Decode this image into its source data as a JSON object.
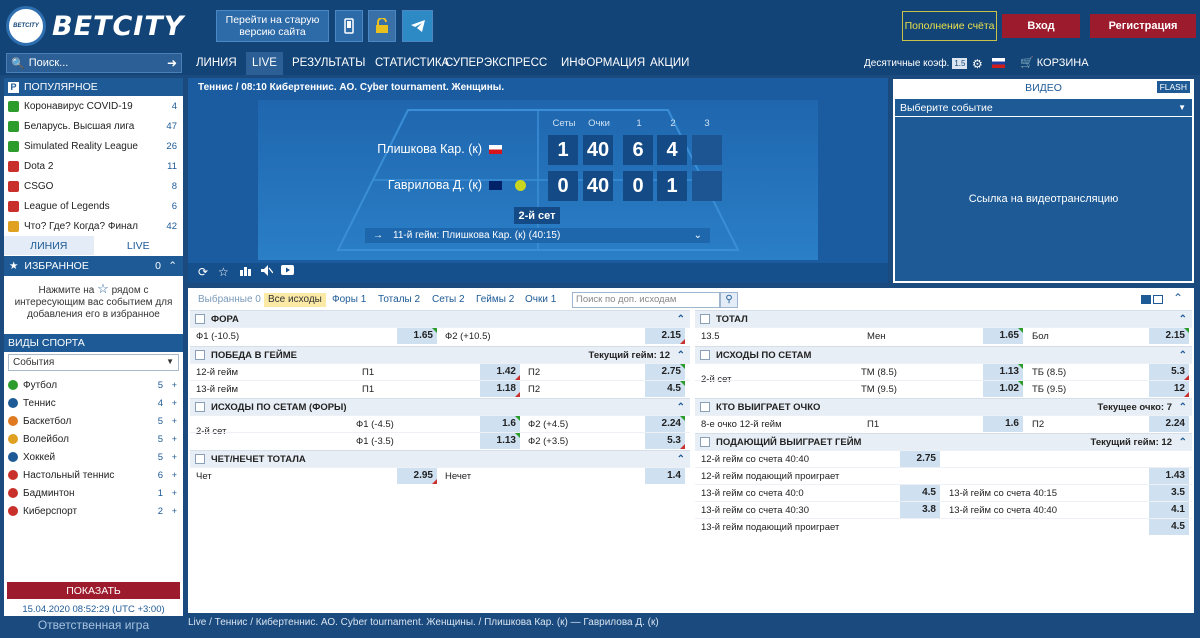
{
  "header": {
    "logo_badge": "BETCITY",
    "logo_text": "BETCITY",
    "old_version": "Перейти на старую версию сайта",
    "topup": "Пополнение счёта",
    "login": "Вход",
    "register": "Регистрация"
  },
  "nav": {
    "search_placeholder": "Поиск...",
    "items": [
      "ЛИНИЯ",
      "LIVE",
      "РЕЗУЛЬТАТЫ",
      "СТАТИСТИКА",
      "СУПЕРЭКСПРЕСС",
      "ИНФОРМАЦИЯ",
      "АКЦИИ"
    ],
    "decimal": "Десятичные коэф.",
    "decimal_badge": "1.5",
    "cart": "КОРЗИНА"
  },
  "sidebar": {
    "popular_title": "ПОПУЛЯРНОЕ",
    "popular": [
      {
        "label": "Коронавирус COVID-19",
        "count": "4",
        "color": "#2c9c2c"
      },
      {
        "label": "Беларусь. Высшая лига",
        "count": "47",
        "color": "#2c9c2c"
      },
      {
        "label": "Simulated Reality League",
        "count": "26",
        "color": "#2c9c2c"
      },
      {
        "label": "Dota 2",
        "count": "11",
        "color": "#c9302c"
      },
      {
        "label": "CSGO",
        "count": "8",
        "color": "#c9302c"
      },
      {
        "label": "League of Legends",
        "count": "6",
        "color": "#c9302c"
      },
      {
        "label": "Что? Где? Когда? Финал",
        "count": "42",
        "color": "#e0a020"
      }
    ],
    "tab_line": "ЛИНИЯ",
    "tab_live": "LIVE",
    "fav_title": "ИЗБРАННОЕ",
    "fav_count": "0",
    "fav_text_1": "Нажмите на",
    "fav_text_2": "рядом с интересующим вас событием для добавления его в избранное",
    "sports_title": "ВИДЫ СПОРТА",
    "sports_select": "События",
    "sports": [
      {
        "label": "Футбол",
        "count": "5",
        "color": "#2c9c2c"
      },
      {
        "label": "Теннис",
        "count": "4",
        "color": "#1d5a96"
      },
      {
        "label": "Баскетбол",
        "count": "5",
        "color": "#e07a20"
      },
      {
        "label": "Волейбол",
        "count": "5",
        "color": "#e0a020"
      },
      {
        "label": "Хоккей",
        "count": "5",
        "color": "#1d5a96"
      },
      {
        "label": "Настольный теннис",
        "count": "6",
        "color": "#c9302c"
      },
      {
        "label": "Бадминтон",
        "count": "1",
        "color": "#c9302c"
      },
      {
        "label": "Киберспорт",
        "count": "2",
        "color": "#c9302c"
      }
    ],
    "show": "ПОКАЗАТЬ",
    "datetime": "15.04.2020 08:52:29 (UTC +3:00)",
    "responsible": "Ответственная игра"
  },
  "match": {
    "title": "Теннис  /  08:10 Кибертеннис. АО. Cyber tournament. Женщины.",
    "headers": [
      "Сеты",
      "Очки",
      "1",
      "2",
      "3"
    ],
    "player1": {
      "name": "Плишкова Кар. (к)",
      "scores": [
        "1",
        "40",
        "6",
        "4",
        ""
      ]
    },
    "player2": {
      "name": "Гаврилова Д. (к)",
      "scores": [
        "0",
        "40",
        "0",
        "1",
        ""
      ]
    },
    "set": "2-й сет",
    "game": "11-й гейм: Плишкова Кар. (к) (40:15)"
  },
  "video": {
    "tab": "ВИДЕО",
    "flash": "FLASH",
    "select": "Выберите событие",
    "link": "Ссылка на видеотрансляцию"
  },
  "markets": {
    "tabs": [
      "Выбранные 0",
      "Все исходы",
      "Форы 1",
      "Тоталы 2",
      "Сеты 2",
      "Геймы 2",
      "Очки 1"
    ],
    "search_placeholder": "Поиск по доп. исходам",
    "fora": {
      "title": "ФОРА",
      "r1": [
        "Ф1 (-10.5)",
        "1.65",
        "Ф2 (+10.5)",
        "2.15"
      ]
    },
    "pobeda": {
      "title": "ПОБЕДА В ГЕЙМЕ",
      "right": "Текущий гейм: 12",
      "rows": [
        [
          "12-й гейм",
          "П1",
          "1.42",
          "П2",
          "2.75"
        ],
        [
          "13-й гейм",
          "П1",
          "1.18",
          "П2",
          "4.5"
        ]
      ]
    },
    "sety_fora": {
      "title": "ИСХОДЫ ПО СЕТАМ (ФОРЫ)",
      "label": "2-й сет",
      "rows": [
        [
          "Ф1 (-4.5)",
          "1.6",
          "Ф2 (+4.5)",
          "2.24"
        ],
        [
          "Ф1 (-3.5)",
          "1.13",
          "Ф2 (+3.5)",
          "5.3"
        ]
      ]
    },
    "chet": {
      "title": "ЧЕТ/НЕЧЕТ ТОТАЛА",
      "r1": [
        "Чет",
        "2.95",
        "Нечет",
        "1.4"
      ]
    },
    "total": {
      "title": "ТОТАЛ",
      "r1": [
        "13.5",
        "Мен",
        "1.65",
        "Бол",
        "2.15"
      ]
    },
    "sety": {
      "title": "ИСХОДЫ ПО СЕТАМ",
      "label": "2-й сет",
      "rows": [
        [
          "ТМ (8.5)",
          "1.13",
          "ТБ (8.5)",
          "5.3"
        ],
        [
          "ТМ (9.5)",
          "1.02",
          "ТБ (9.5)",
          "12"
        ]
      ]
    },
    "ochko": {
      "title": "КТО ВЫИГРАЕТ ОЧКО",
      "right": "Текущее очко: 7",
      "r1": [
        "8-е очко 12-й гейм",
        "П1",
        "1.6",
        "П2",
        "2.24"
      ]
    },
    "podayushchiy": {
      "title": "ПОДАЮЩИЙ ВЫИГРАЕТ ГЕЙМ",
      "right": "Текущий гейм: 12",
      "r1": [
        "12-й гейм со счета 40:40",
        "2.75"
      ],
      "r2": [
        "12-й гейм подающий проиграет",
        "1.43"
      ],
      "r3": [
        "13-й гейм со счета 40:0",
        "4.5",
        "13-й гейм со счета 40:15",
        "3.5"
      ],
      "r4": [
        "13-й гейм со счета 40:30",
        "3.8",
        "13-й гейм со счета 40:40",
        "4.1"
      ],
      "r5": [
        "13-й гейм подающий проиграет",
        "4.5"
      ]
    }
  },
  "breadcrumb": "Live / Теннис / Кибертеннис. АО. Cyber tournament. Женщины. / Плишкова Кар. (к) — Гаврилова Д. (к)"
}
